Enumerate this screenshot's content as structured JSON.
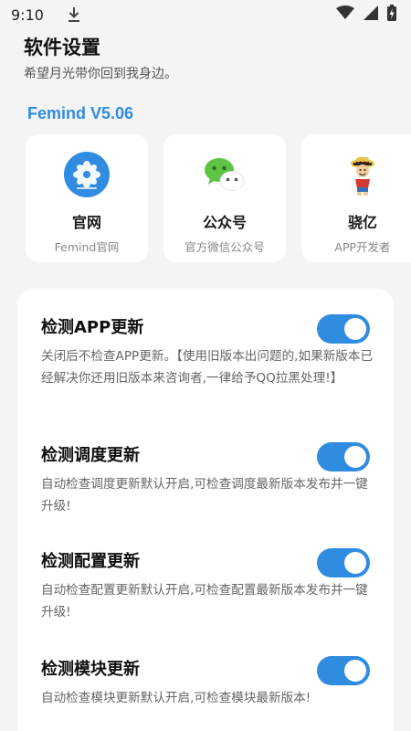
{
  "status_bar": {
    "time": "9:10",
    "icons": [
      "download-icon",
      "wifi-icon",
      "signal-icon",
      "battery-charging-icon"
    ]
  },
  "header": {
    "title": "软件设置",
    "subtitle": "希望月光带你回到我身边。"
  },
  "version": "Femind V5.06",
  "cards": [
    {
      "name": "官网",
      "desc": "Femind官网",
      "icon": "flower-logo-icon"
    },
    {
      "name": "公众号",
      "desc": "官方微信公众号",
      "icon": "wechat-icon"
    },
    {
      "name": "骁亿",
      "desc": "APP开发者",
      "icon": "developer-avatar"
    }
  ],
  "settings": [
    {
      "title": "检测APP更新",
      "desc": "关闭后不检查APP更新。【使用旧版本出问题的,如果新版本已经解决你还用旧版本来咨询者,一律给予QQ拉黑处理!】",
      "enabled": true
    },
    {
      "title": "检测调度更新",
      "desc": "自动检查调度更新默认开启,可检查调度最新版本发布并一键升级!",
      "enabled": true
    },
    {
      "title": "检测配置更新",
      "desc": "自动检查配置更新默认开启,可检查配置最新版本发布并一键升级!",
      "enabled": true
    },
    {
      "title": "检测模块更新",
      "desc": "自动检查模块更新默认开启,可检查模块最新版本!",
      "enabled": true
    }
  ],
  "colors": {
    "accent": "#2f8ce0",
    "background": "#f4f4f4",
    "card": "#ffffff",
    "wechat_green": "#5fc446"
  }
}
